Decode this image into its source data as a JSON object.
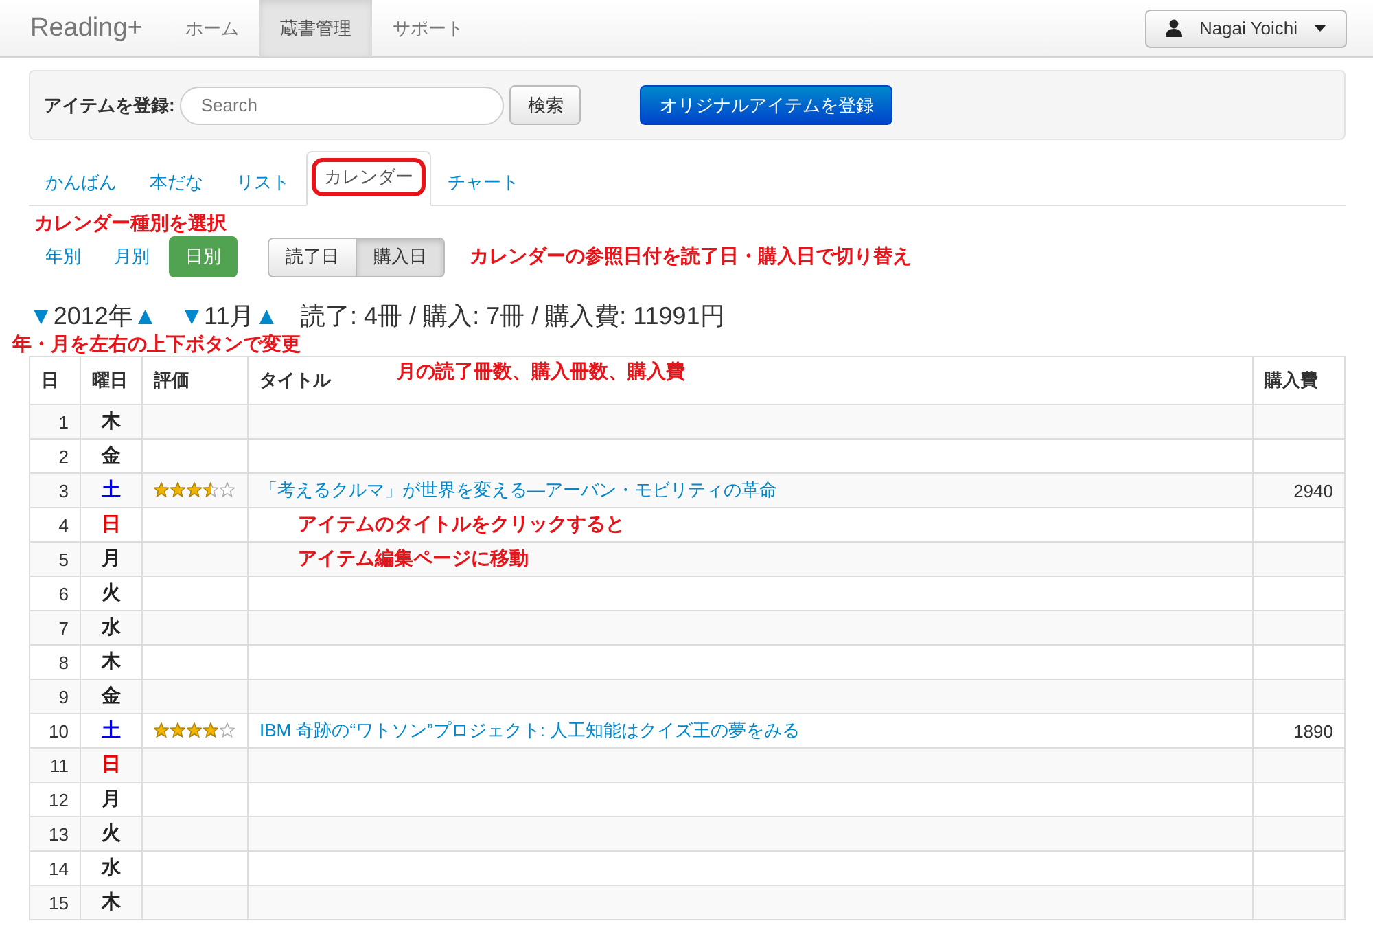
{
  "navbar": {
    "brand": "Reading+",
    "items": [
      {
        "label": "ホーム",
        "selected": false
      },
      {
        "label": "蔵書管理",
        "selected": true
      },
      {
        "label": "サポート",
        "selected": false
      }
    ],
    "user": "Nagai Yoichi"
  },
  "register": {
    "label": "アイテムを登録:",
    "placeholder": "Search",
    "search_button": "検索",
    "original_button": "オリジナルアイテムを登録"
  },
  "tabs": [
    {
      "label": "かんばん",
      "selected": false
    },
    {
      "label": "本だな",
      "selected": false
    },
    {
      "label": "リスト",
      "selected": false
    },
    {
      "label": "カレンダー",
      "selected": true
    },
    {
      "label": "チャート",
      "selected": false
    }
  ],
  "tabs_note": "カレンダー種別を選択",
  "calendar_types": [
    {
      "label": "年別",
      "selected": false
    },
    {
      "label": "月別",
      "selected": false
    },
    {
      "label": "日別",
      "selected": true
    }
  ],
  "date_basis": [
    {
      "label": "読了日",
      "selected": false
    },
    {
      "label": "購入日",
      "selected": true
    }
  ],
  "date_basis_note": "カレンダーの参照日付を読了日・購入日で切り替え",
  "period": {
    "down": "▼",
    "up": "▲",
    "year": "2012年",
    "month": "11月",
    "summary": "読了: 4冊 / 購入: 7冊 / 購入費: 11991円"
  },
  "period_note": "年・月を左右の上下ボタンで変更",
  "table": {
    "columns": [
      "日",
      "曜日",
      "評価",
      "タイトル",
      "購入費"
    ],
    "header_note": "月の読了冊数、購入冊数、購入費",
    "rows": [
      {
        "day": "1",
        "weekday": "木",
        "kind": "weekday"
      },
      {
        "day": "2",
        "weekday": "金",
        "kind": "weekday"
      },
      {
        "day": "3",
        "weekday": "土",
        "kind": "saturday",
        "stars": 3.5,
        "title": "「考えるクルマ」が世界を変える―アーバン・モビリティの革命",
        "cost": "2940"
      },
      {
        "day": "4",
        "weekday": "日",
        "kind": "sunday",
        "note": "アイテムのタイトルをクリックすると"
      },
      {
        "day": "5",
        "weekday": "月",
        "kind": "weekday",
        "note": "アイテム編集ページに移動"
      },
      {
        "day": "6",
        "weekday": "火",
        "kind": "weekday"
      },
      {
        "day": "7",
        "weekday": "水",
        "kind": "weekday"
      },
      {
        "day": "8",
        "weekday": "木",
        "kind": "weekday"
      },
      {
        "day": "9",
        "weekday": "金",
        "kind": "weekday"
      },
      {
        "day": "10",
        "weekday": "土",
        "kind": "saturday",
        "stars": 4,
        "title": "IBM 奇跡の“ワトソン”プロジェクト: 人工知能はクイズ王の夢をみる",
        "cost": "1890"
      },
      {
        "day": "11",
        "weekday": "日",
        "kind": "sunday"
      },
      {
        "day": "12",
        "weekday": "月",
        "kind": "weekday"
      },
      {
        "day": "13",
        "weekday": "火",
        "kind": "weekday"
      },
      {
        "day": "14",
        "weekday": "水",
        "kind": "weekday"
      },
      {
        "day": "15",
        "weekday": "木",
        "kind": "weekday"
      }
    ]
  }
}
